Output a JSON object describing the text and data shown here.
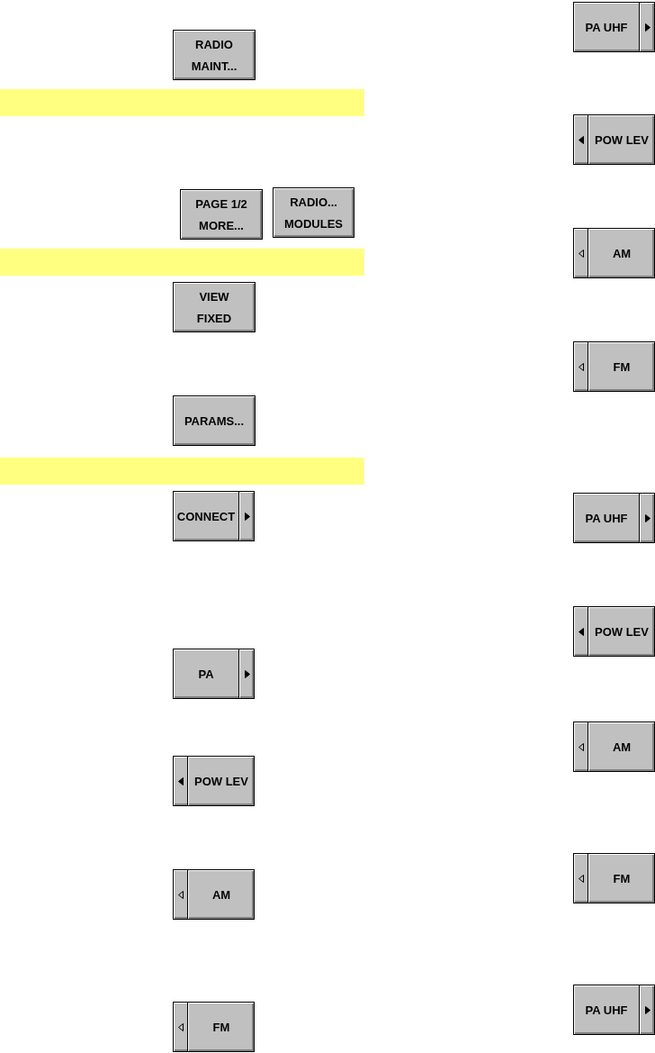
{
  "left_column": [
    {
      "kind": "plain",
      "label": "RADIO\nMAINT..."
    },
    {
      "kind": "band"
    },
    {
      "kind": "pair",
      "buttons": [
        {
          "kind": "plain",
          "label": "PAGE 1/2\nMORE..."
        },
        {
          "kind": "plain",
          "label": "RADIO...\nMODULES"
        }
      ]
    },
    {
      "kind": "band"
    },
    {
      "kind": "plain",
      "label": "VIEW\nFIXED"
    },
    {
      "kind": "plain",
      "label": "PARAMS..."
    },
    {
      "kind": "band"
    },
    {
      "kind": "arrow-right",
      "label": "CONNECT",
      "arrow_filled": true
    },
    {
      "kind": "arrow-right",
      "label": "PA",
      "arrow_filled": true
    },
    {
      "kind": "arrow-left",
      "label": "POW LEV",
      "arrow_filled": true
    },
    {
      "kind": "arrow-left",
      "label": "AM",
      "arrow_filled": false
    },
    {
      "kind": "arrow-left",
      "label": "FM",
      "arrow_filled": false
    }
  ],
  "right_column": [
    {
      "kind": "arrow-right",
      "label": "PA UHF",
      "arrow_filled": true
    },
    {
      "kind": "arrow-left",
      "label": "POW LEV",
      "arrow_filled": true
    },
    {
      "kind": "arrow-left",
      "label": "AM",
      "arrow_filled": false
    },
    {
      "kind": "arrow-left",
      "label": "FM",
      "arrow_filled": false
    },
    {
      "kind": "arrow-right",
      "label": "PA UHF",
      "arrow_filled": true
    },
    {
      "kind": "arrow-left",
      "label": "POW LEV",
      "arrow_filled": true
    },
    {
      "kind": "arrow-left",
      "label": "AM",
      "arrow_filled": false
    },
    {
      "kind": "arrow-left",
      "label": "FM",
      "arrow_filled": false
    },
    {
      "kind": "arrow-right",
      "label": "PA UHF",
      "arrow_filled": true
    }
  ]
}
